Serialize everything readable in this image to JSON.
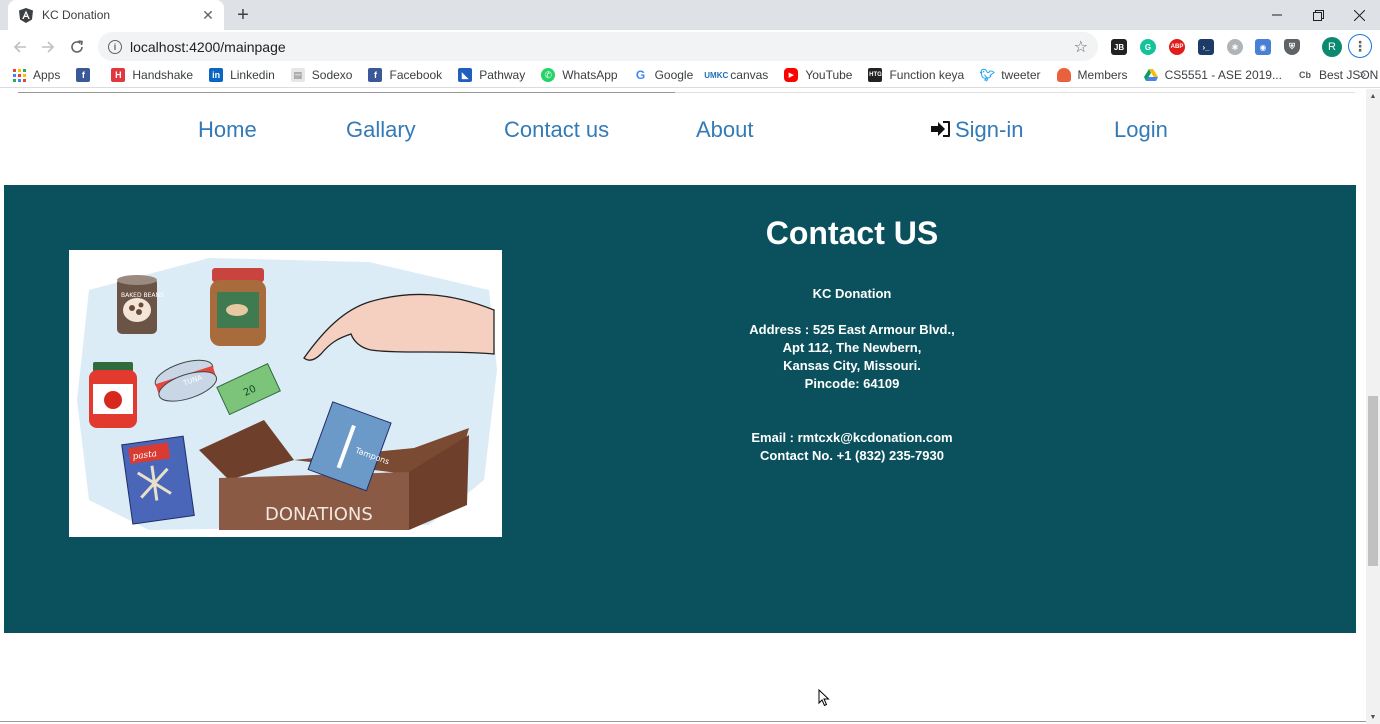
{
  "browser": {
    "tab_title": "KC Donation",
    "url": "localhost:4200/mainpage",
    "profile_initial": "R",
    "bookmarks": [
      {
        "label": "Apps",
        "icon": "apps-grid-icon",
        "color": "#4285f4"
      },
      {
        "label": "",
        "icon": "facebook-icon",
        "color": "#3b5998"
      },
      {
        "label": "Handshake",
        "icon": "handshake-icon",
        "color": "#e0383e"
      },
      {
        "label": "Linkedin",
        "icon": "linkedin-icon",
        "color": "#0a66c2"
      },
      {
        "label": "Sodexo",
        "icon": "sodexo-icon",
        "color": "#9aa0a6"
      },
      {
        "label": "Facebook",
        "icon": "facebook-icon",
        "color": "#3b5998"
      },
      {
        "label": "Pathway",
        "icon": "pathway-icon",
        "color": "#1f5fbf"
      },
      {
        "label": "WhatsApp",
        "icon": "whatsapp-icon",
        "color": "#25d366"
      },
      {
        "label": "Google",
        "icon": "google-icon",
        "color": "#4285f4"
      },
      {
        "label": "canvas",
        "icon": "canvas-icon",
        "color": "#1f6fb5"
      },
      {
        "label": "YouTube",
        "icon": "youtube-icon",
        "color": "#ff0000"
      },
      {
        "label": "Function keya",
        "icon": "htg-icon",
        "color": "#222222"
      },
      {
        "label": "tweeter",
        "icon": "twitter-icon",
        "color": "#1da1f2"
      },
      {
        "label": "Members",
        "icon": "members-icon",
        "color": "#e8603c"
      },
      {
        "label": "CS5551 - ASE 2019...",
        "icon": "google-drive-icon",
        "color": "#0f9d58"
      },
      {
        "label": "Best JSON Viewer a...",
        "icon": "cb-icon",
        "color": "#555555"
      }
    ],
    "bookmarks_more": "»"
  },
  "nav": {
    "home": "Home",
    "gallery": "Gallary",
    "contact": "Contact us",
    "about": "About",
    "signin": "Sign-in",
    "login": "Login"
  },
  "contact": {
    "title": "Contact US",
    "org": "KC Donation",
    "address_1": "Address : 525 East Armour Blvd.,",
    "address_2": "Apt 112, The Newbern,",
    "address_3": "Kansas City, Missouri.",
    "pincode": "Pincode: 64109",
    "email": "Email : rmtcxk@kcdonation.com",
    "phone": "Contact No. +1 (832) 235-7930",
    "illustration": {
      "beans_label": "BAKED BEANS",
      "tuna_label": "TUNA",
      "pasta_label": "pasta",
      "tampon_label": "Tampons",
      "money_label": "20",
      "box_label": "DONATIONS"
    }
  },
  "colors": {
    "contact_bg": "#0a515d",
    "link": "#337ab7"
  }
}
